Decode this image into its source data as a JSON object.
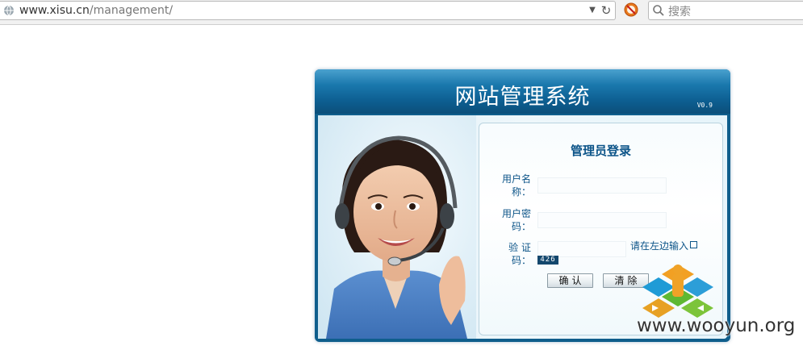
{
  "browser": {
    "url_host": "www.xisu.cn",
    "url_path": "/management/",
    "search_placeholder": "搜索"
  },
  "panel": {
    "title": "网站管理系统",
    "version": "V0.9",
    "login_title": "管理员登录",
    "username_label_1": "用户名",
    "username_label_2": "称：",
    "password_label_1": "用户密",
    "password_label_2": "码：",
    "captcha_label_1": "验 证",
    "captcha_label_2": "码：",
    "captcha_hint": "请在左边输入",
    "captcha_code": "426",
    "confirm_label": "确认",
    "clear_label": "清除"
  },
  "watermark": {
    "text": "www.wooyun.org"
  },
  "colors": {
    "header_blue": "#0f5e8c",
    "label_blue": "#0c5488"
  }
}
